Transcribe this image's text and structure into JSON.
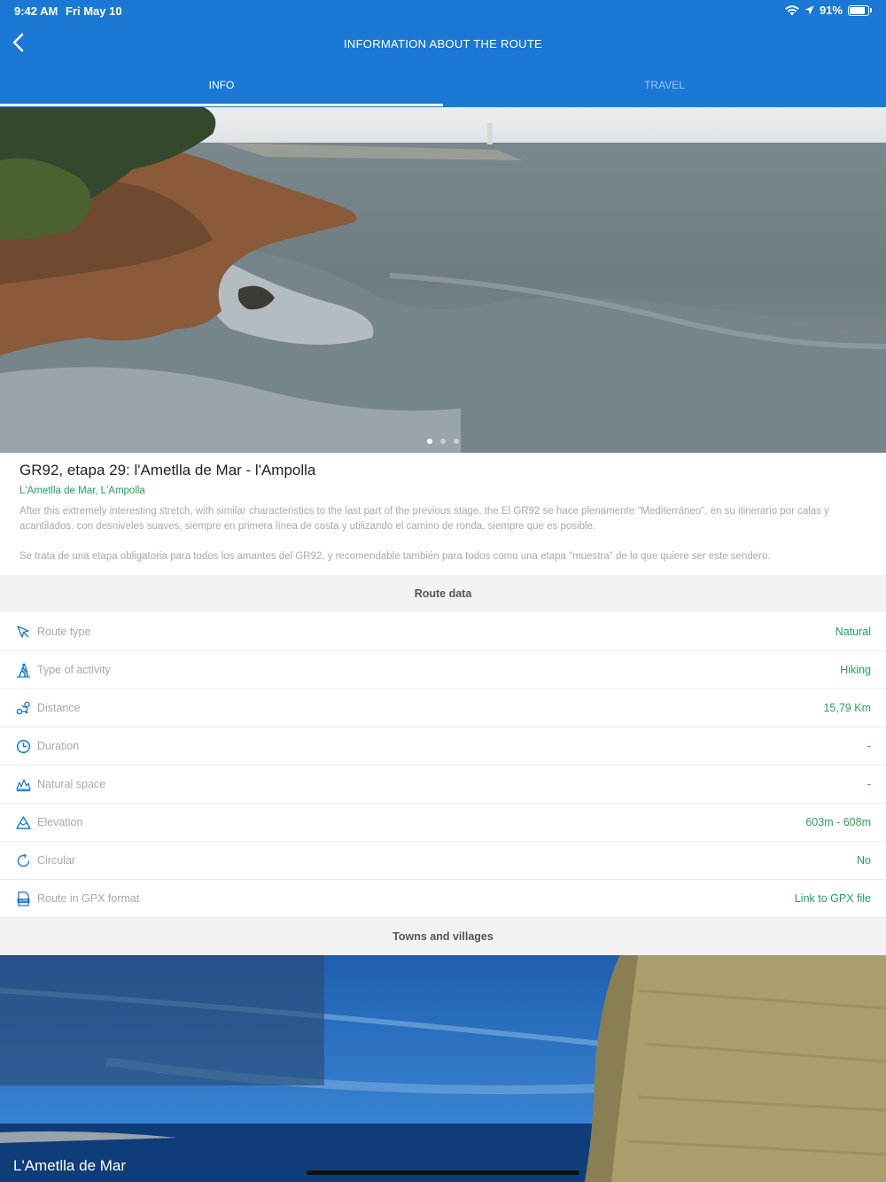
{
  "status": {
    "time": "9:42 AM",
    "date": "Fri May 10",
    "battery": "91%",
    "battery_level": 0.91
  },
  "header": {
    "title": "INFORMATION ABOUT THE ROUTE"
  },
  "tabs": [
    {
      "label": "INFO",
      "active": true
    },
    {
      "label": "TRAVEL",
      "active": false
    }
  ],
  "carousel": {
    "count": 3,
    "active_index": 0
  },
  "route": {
    "title": "GR92, etapa 29: l'Ametlla de Mar - l'Ampolla",
    "places": "L'Ametlla de Mar, L'Ampolla",
    "desc1": "After this extremely interesting stretch, with similar characteristics to the last part of the previous stage, the El GR92 se hace plenamente \"Mediterráneo\", en su itinerario por calas y acantilados, con desniveles suaves, siempre en primera línea de costa y utilizando el camino de ronda, siempre que es posible.",
    "desc2": "Se trata de una etapa obligatoria para todos los amantes del GR92, y recomendable también para todos como una etapa \"muestra\" de lo que quiere ser este sendero."
  },
  "route_data": {
    "heading": "Route data",
    "rows": [
      {
        "icon": "route-type-icon",
        "label": "Route type",
        "value": "Natural"
      },
      {
        "icon": "hiking-icon",
        "label": "Type of activity",
        "value": "Hiking"
      },
      {
        "icon": "distance-icon",
        "label": "Distance",
        "value": "15,79 Km"
      },
      {
        "icon": "clock-icon",
        "label": "Duration",
        "value": "-"
      },
      {
        "icon": "nature-icon",
        "label": "Natural space",
        "value": "-"
      },
      {
        "icon": "elevation-icon",
        "label": "Elevation",
        "value": "603m - 608m"
      },
      {
        "icon": "circular-icon",
        "label": "Circular",
        "value": "No"
      },
      {
        "icon": "gpx-icon",
        "label": "Route in GPX format",
        "value": "Link to GPX file"
      }
    ]
  },
  "towns": {
    "heading": "Towns and villages",
    "name": "L'Ametlla de Mar"
  },
  "colors": {
    "header_bg": "#1b78d4",
    "accent_green": "#25a25a",
    "icon_blue": "#1b78d4"
  }
}
